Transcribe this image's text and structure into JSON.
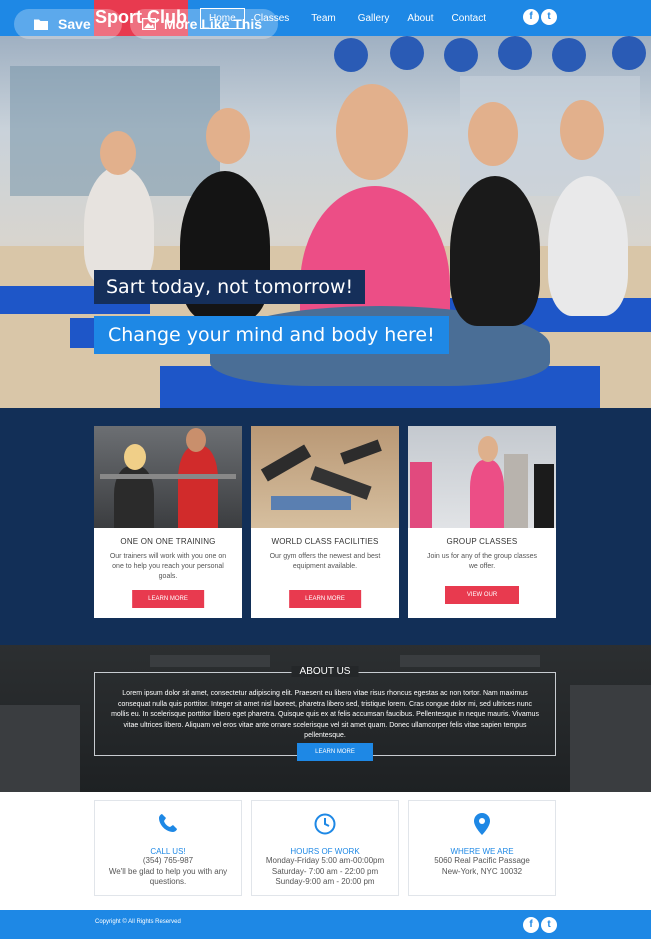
{
  "overlay": {
    "save_label": "Save",
    "more_label": "More Like This"
  },
  "nav": {
    "logo": "Sport Club",
    "items": [
      "Home",
      "Classes",
      "Team",
      "Gallery",
      "About",
      "Contact"
    ],
    "active": "Home",
    "social": [
      "f",
      "t"
    ]
  },
  "hero": {
    "tagline_1": "Sart today, not tomorrow!",
    "tagline_2": "Change your mind and body here!"
  },
  "services": [
    {
      "title": "ONE ON ONE TRAINING",
      "text": "Our trainers will work with you one on one to help you reach your personal goals.",
      "button": "LEARN MORE"
    },
    {
      "title": "WORLD CLASS FACILITIES",
      "text": "Our gym offers the newest and best equipment available.",
      "button": "LEARN MORE"
    },
    {
      "title": "GROUP CLASSES",
      "text": "Join us for any of the group classes we offer.",
      "button": "VIEW OUR CLASSES"
    }
  ],
  "about": {
    "title": "ABOUT US",
    "text": "Lorem ipsum dolor sit amet, consectetur adipiscing elit. Praesent eu libero vitae risus rhoncus egestas ac non tortor. Nam maximus consequat nulla quis porttitor. Integer sit amet nisl laoreet, pharetra libero sed, tristique lorem. Cras congue dolor mi, sed ultrices nunc mollis eu. In scelerisque porttitor libero eget pharetra. Quisque quis ex at felis accumsan faucibus. Pellentesque in neque mauris. Vivamus vitae ultrices libero. Aliquam vel eros vitae ante ornare scelerisque vel sit amet quam. Donec ullamcorper felis vitae sapien tempus pellentesque.",
    "button": "LEARN MORE"
  },
  "contact": [
    {
      "icon": "phone-icon",
      "title": "CALL US!",
      "lines": [
        "(354) 765-987",
        "We'll be glad to help you with any",
        "questions."
      ]
    },
    {
      "icon": "clock-icon",
      "title": "HOURS OF WORK",
      "lines": [
        "Monday-Friday 5:00 am-00:00pm",
        "Saturday- 7:00 am - 22:00 pm",
        "Sunday-9:00 am - 20:00 pm"
      ]
    },
    {
      "icon": "map-pin-icon",
      "title": "WHERE WE ARE",
      "lines": [
        "5060 Real Pacific Passage",
        "New-York, NYC  10032"
      ]
    }
  ],
  "footer": {
    "copyright": "Copyright © All Rights Reserved",
    "social": [
      "f",
      "t"
    ]
  },
  "colors": {
    "primary": "#1e88e5",
    "accent": "#e83a4f",
    "dark_navy": "#122f57"
  }
}
